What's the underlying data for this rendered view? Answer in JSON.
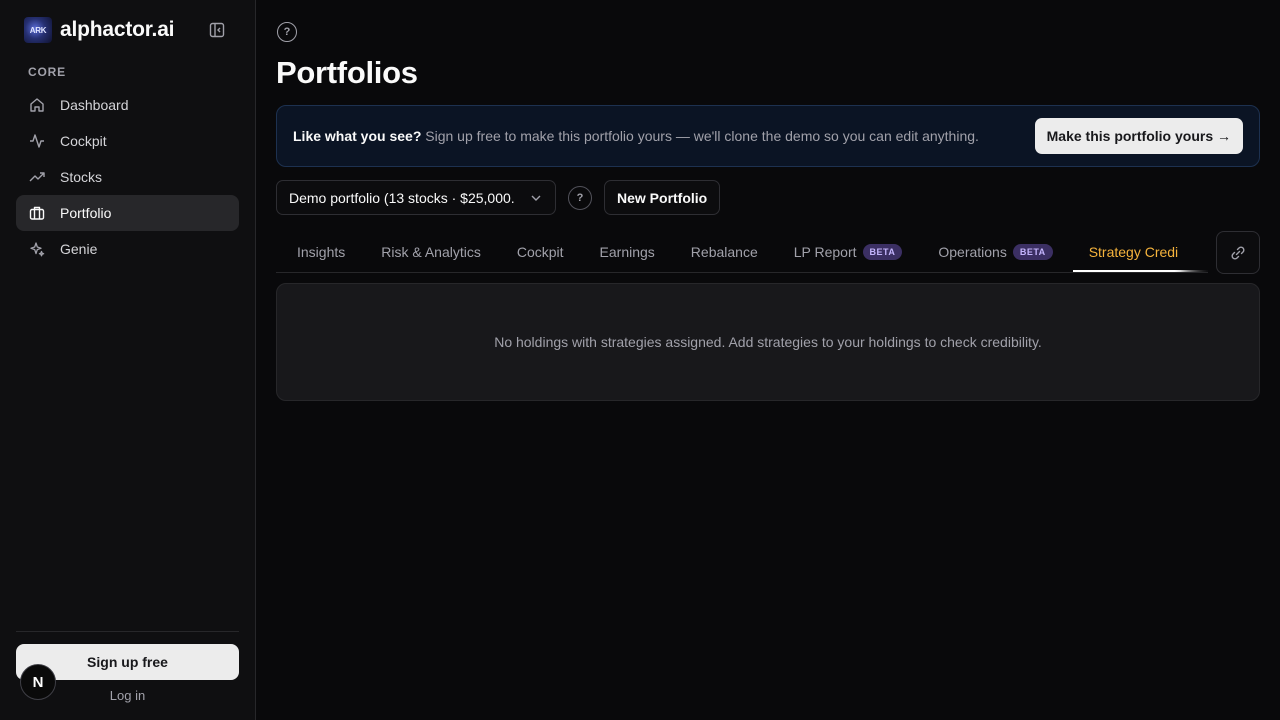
{
  "brand": {
    "name": "alphactor.ai",
    "logo_text": "ARK"
  },
  "sidebar": {
    "section": "CORE",
    "items": [
      {
        "label": "Dashboard",
        "icon": "home-icon"
      },
      {
        "label": "Cockpit",
        "icon": "activity-icon"
      },
      {
        "label": "Stocks",
        "icon": "trending-up-icon"
      },
      {
        "label": "Portfolio",
        "icon": "briefcase-icon",
        "active": true
      },
      {
        "label": "Genie",
        "icon": "sparkles-icon"
      }
    ],
    "signup_label": "Sign up free",
    "login_label": "Log in",
    "n_badge": "N"
  },
  "page": {
    "title": "Portfolios",
    "help": "?"
  },
  "banner": {
    "lead": "Like what you see?",
    "text": " Sign up free to make this portfolio yours — we'll clone the demo so you can edit anything.",
    "cta": "Make this portfolio yours →"
  },
  "toolbar": {
    "selected_portfolio": "Demo portfolio (13 stocks · $25,000.",
    "help": "?",
    "new_portfolio": "New Portfolio"
  },
  "tabs": [
    {
      "label": "Insights"
    },
    {
      "label": "Risk & Analytics"
    },
    {
      "label": "Cockpit"
    },
    {
      "label": "Earnings"
    },
    {
      "label": "Rebalance"
    },
    {
      "label": "LP Report",
      "badge": "BETA"
    },
    {
      "label": "Operations",
      "badge": "BETA"
    },
    {
      "label": "Strategy Credi",
      "active": true
    }
  ],
  "empty": {
    "message": "No holdings with strategies assigned. Add strategies to your holdings to check credibility."
  },
  "colors": {
    "accent": "#f5b33c",
    "beta_bg": "#3b2f63",
    "beta_text": "#c4b5fd",
    "banner_bg": "#0b1424"
  }
}
